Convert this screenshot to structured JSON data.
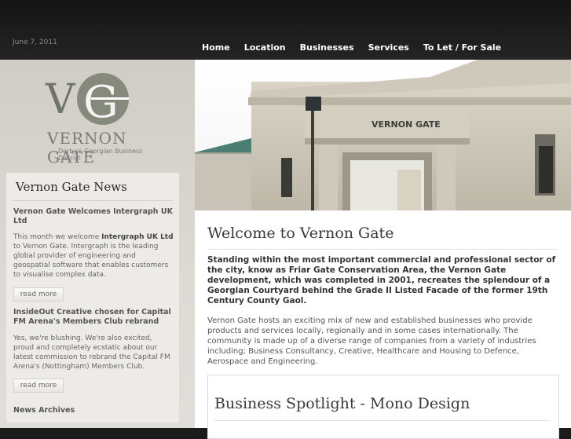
{
  "header": {
    "date": "June 7, 2011"
  },
  "nav": {
    "items": [
      "Home",
      "Location",
      "Businesses",
      "Services",
      "To Let / For Sale"
    ]
  },
  "logo": {
    "title": "VERNON GATE",
    "subtitle": "Derby's Georgian Business District",
    "monogram": "VG"
  },
  "news": {
    "title": "Vernon Gate News",
    "items": [
      {
        "heading": "Vernon Gate Welcomes Intergraph UK Ltd",
        "text_pre": "This month we welcome ",
        "text_bold": "Intergraph UK Ltd",
        "text_post": " to Vernon Gate. Intergraph is the leading global provider of engineering and geospatial software that enables customers to visualise complex data.",
        "more": "read more"
      },
      {
        "heading": "InsideOut Creative chosen for Capital FM Arena's Members Club rebrand",
        "text": "Yes, we're blushing. We're also excited, proud and completely ecstatic about our latest commission to rebrand the Capital FM Arena's (Nottingham) Members Club.",
        "more": "read more"
      }
    ],
    "archives": "News Archives"
  },
  "hero": {
    "sign": "VERNON GATE"
  },
  "main": {
    "title": "Welcome to Vernon Gate",
    "lead": "Standing within the most important commercial and professional sector of the city, know as Friar Gate Conservation Area, the Vernon Gate development, which was completed in 2001, recreates the splendour of a Georgian Courtyard behind the Grade II Listed Facade of the former 19th Century County Gaol.",
    "body": "Vernon Gate hosts an exciting mix of new and established businesses who provide products and services locally, regionally and in some cases internationally. The community is made up of a diverse range of companies from a variety of industries including; Business Consultancy, Creative, Healthcare and Housing to Defence, Aerospace and Engineering.",
    "spotlight_title": "Business Spotlight - Mono Design"
  }
}
